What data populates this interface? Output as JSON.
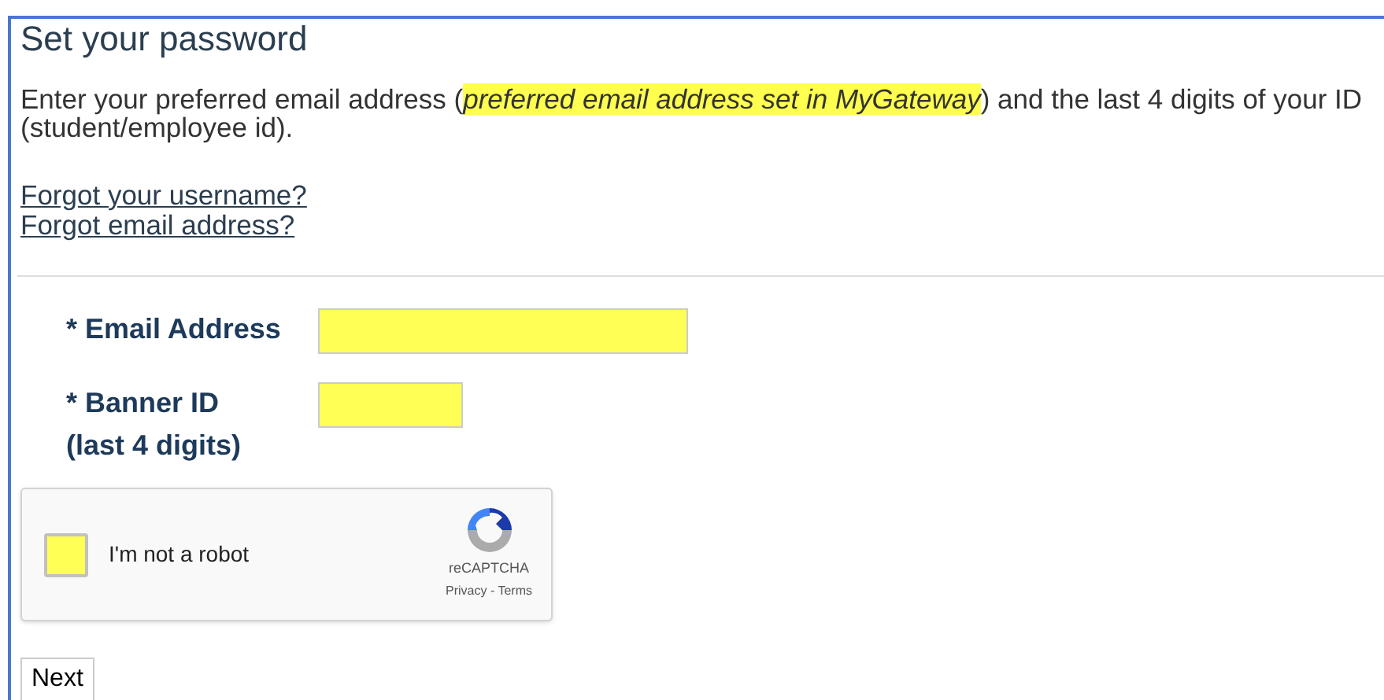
{
  "title": "Set your password",
  "intro": {
    "before": "Enter your preferred email address (",
    "highlight": "preferred email address set in MyGateway",
    "after": ") and the last 4 digits of your ID",
    "continuation": "(student/employee id)."
  },
  "links": [
    "Forgot your username?",
    "Forgot email address?"
  ],
  "fields": [
    {
      "label": "* Email Address"
    },
    {
      "label": "* Banner ID",
      "note": "(last 4 digits)"
    }
  ],
  "captcha": {
    "label": "I'm not a robot",
    "checked": false,
    "brand": "reCAPTCHA",
    "footer": "Privacy - Terms"
  },
  "button": "Next"
}
